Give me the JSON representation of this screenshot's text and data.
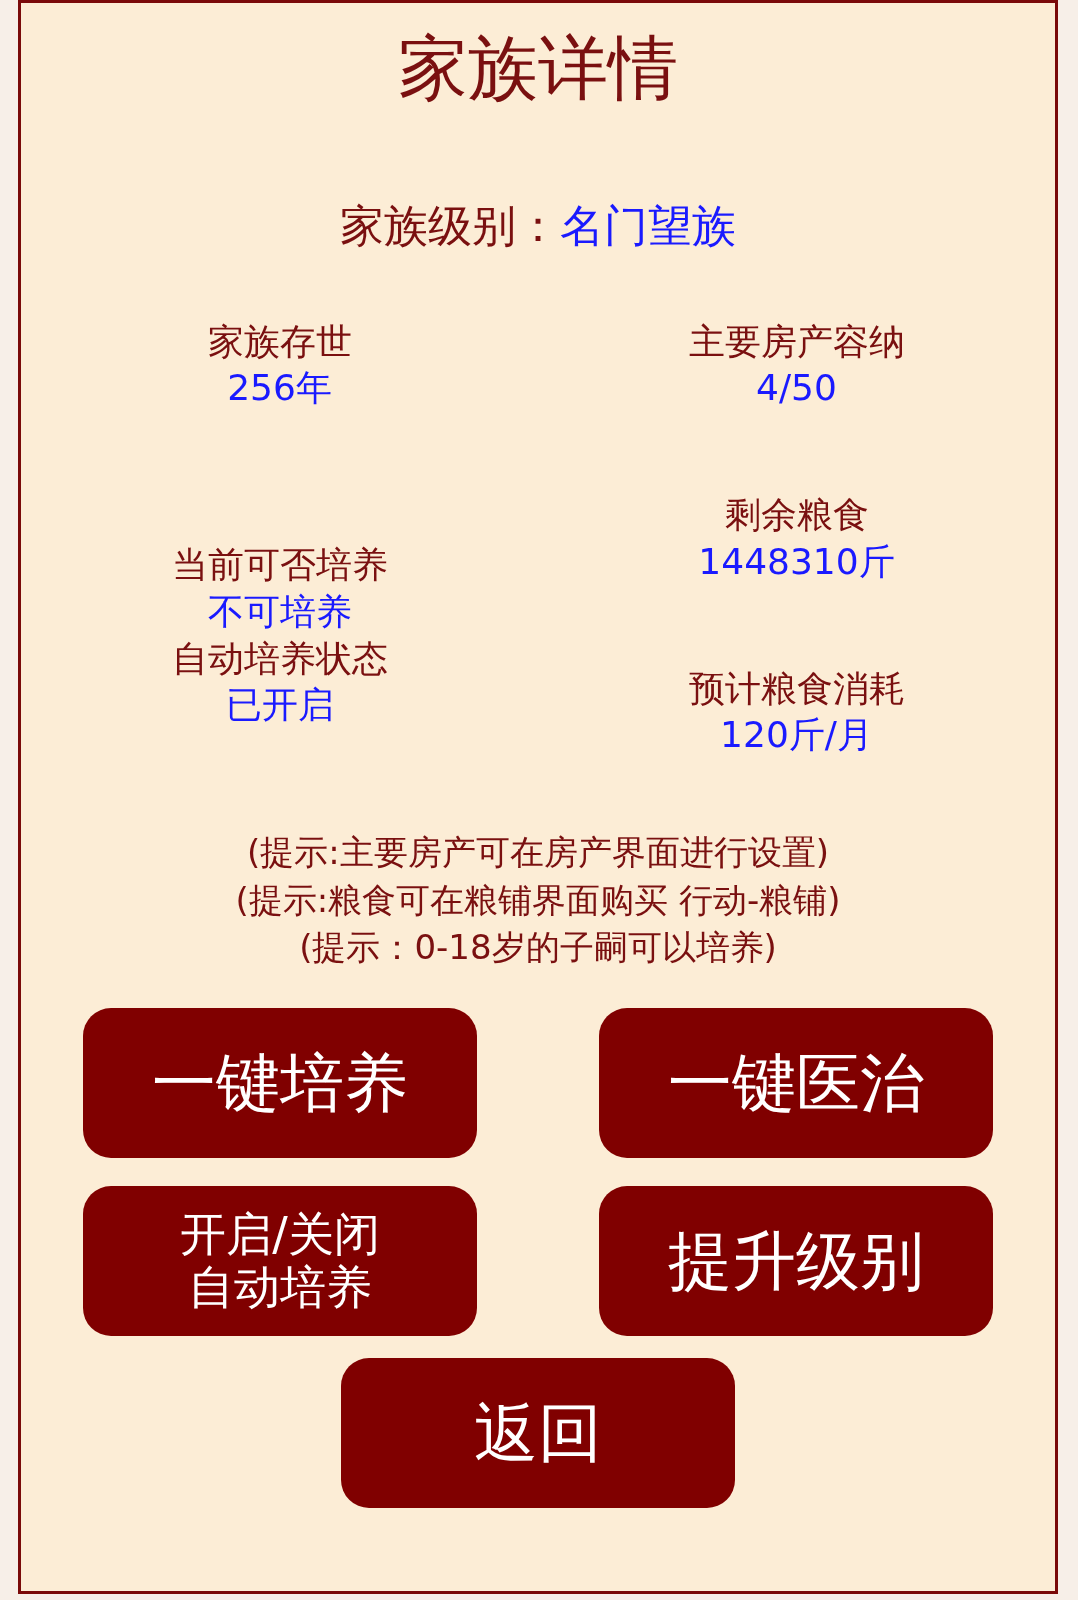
{
  "title": "家族详情",
  "level": {
    "label": "家族级别：",
    "value": "名门望族"
  },
  "left_column": [
    {
      "items": [
        {
          "label": "家族存世",
          "value": "256年"
        }
      ]
    },
    {
      "items": [
        {
          "label": "当前可否培养",
          "value": "不可培养"
        },
        {
          "label": "自动培养状态",
          "value": "已开启"
        }
      ]
    }
  ],
  "right_column": [
    {
      "items": [
        {
          "label": "主要房产容纳",
          "value": "4/50"
        }
      ]
    },
    {
      "items": [
        {
          "label": "剩余粮食",
          "value": "1448310斤"
        }
      ]
    },
    {
      "items": [
        {
          "label": "预计粮食消耗",
          "value": "120斤/月"
        }
      ]
    }
  ],
  "hints": [
    "(提示:主要房产可在房产界面进行设置)",
    "(提示:粮食可在粮铺界面购买 行动-粮铺)",
    "(提示：0-18岁的子嗣可以培养)"
  ],
  "buttons": [
    {
      "lines": [
        "一键培养"
      ]
    },
    {
      "lines": [
        "一键医治"
      ]
    },
    {
      "lines": [
        "开启/关闭",
        "自动培养"
      ]
    },
    {
      "lines": [
        "提升级别"
      ]
    }
  ],
  "back_button": {
    "label": "返回"
  }
}
